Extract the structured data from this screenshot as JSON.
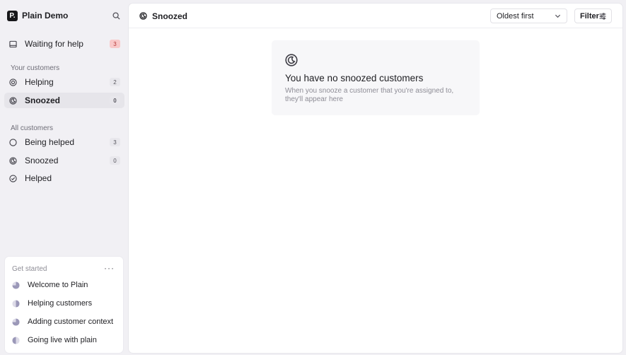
{
  "workspace": {
    "logo_letter": "P.",
    "name": "Plain Demo"
  },
  "sidebar": {
    "top_items": [
      {
        "label": "Waiting for help",
        "count": "3",
        "icon": "inbox-icon"
      }
    ],
    "your_customers": {
      "title": "Your customers",
      "items": [
        {
          "label": "Helping",
          "count": "2",
          "icon": "helping-icon"
        },
        {
          "label": "Snoozed",
          "count": "0",
          "icon": "snooze-icon"
        }
      ]
    },
    "all_customers": {
      "title": "All customers",
      "items": [
        {
          "label": "Being helped",
          "count": "3",
          "icon": "circle-icon"
        },
        {
          "label": "Snoozed",
          "count": "0",
          "icon": "snooze-icon"
        },
        {
          "label": "Helped",
          "icon": "check-circle-icon"
        }
      ]
    },
    "get_started": {
      "title": "Get started",
      "more": "···",
      "items": [
        {
          "label": "Welcome to Plain",
          "icon": "progress-pie-icon",
          "progress": 0.75
        },
        {
          "label": "Helping customers",
          "icon": "progress-pie-icon",
          "progress": 0.5
        },
        {
          "label": "Adding customer context",
          "icon": "progress-pie-icon",
          "progress": 0.75
        },
        {
          "label": "Going live with plain",
          "icon": "progress-pie-icon",
          "progress": 0.5
        }
      ]
    }
  },
  "main": {
    "title": "Snoozed",
    "sort": {
      "value": "Oldest first"
    },
    "filter_label": "Filter",
    "empty_state": {
      "title": "You have no snoozed customers",
      "description": "When you snooze a customer that you're assigned to, they'll appear here"
    }
  },
  "colors": {
    "background": "#f1f0f4",
    "panel": "#ffffff",
    "active_item": "#e6e5ea",
    "alert_badge": "#f9c9c9",
    "alert_badge_text": "#b53a3a",
    "muted_text": "#8e8d96",
    "progress_fill": "#9b98b8"
  }
}
